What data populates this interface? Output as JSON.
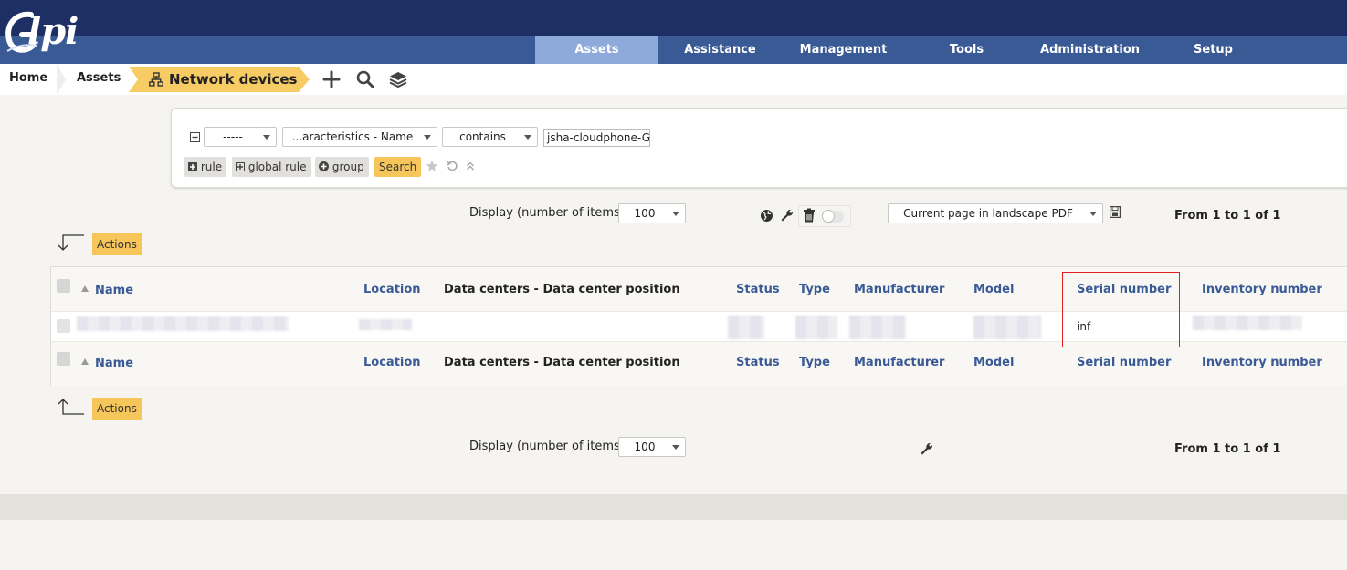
{
  "app": {
    "logo_text": "lpi"
  },
  "menu": [
    {
      "label": "Assets",
      "active": true
    },
    {
      "label": "Assistance"
    },
    {
      "label": "Management"
    },
    {
      "label": "Tools"
    },
    {
      "label": "Administration"
    },
    {
      "label": "Setup"
    }
  ],
  "breadcrumb": {
    "home": "Home",
    "assets": "Assets",
    "current": "Network devices"
  },
  "toolbar_icons": [
    "plus-icon",
    "search-icon",
    "layers-icon"
  ],
  "search": {
    "link_select": "-----",
    "field_select": "...aracteristics - Name",
    "operator_select": "contains",
    "value": "jsha-cloudphone-Ga",
    "rule_label": "rule",
    "global_rule_label": "global rule",
    "group_label": "group",
    "search_label": "Search"
  },
  "display": {
    "label": "Display (number of items)",
    "value": "100",
    "export_option": "Current page in landscape PDF",
    "pager_text": "From 1 to 1 of 1"
  },
  "actions_label": "Actions",
  "table": {
    "columns": [
      "Name",
      "Location",
      "Data centers - Data center position",
      "Status",
      "Type",
      "Manufacturer",
      "Model",
      "Serial number",
      "Inventory number"
    ],
    "rows": [
      {
        "serial_number": "inf"
      }
    ]
  },
  "colors": {
    "accent": "#f7c65a",
    "header_dark": "#1e2f66",
    "nav": "#3a5a96",
    "highlight": "#e02020"
  }
}
